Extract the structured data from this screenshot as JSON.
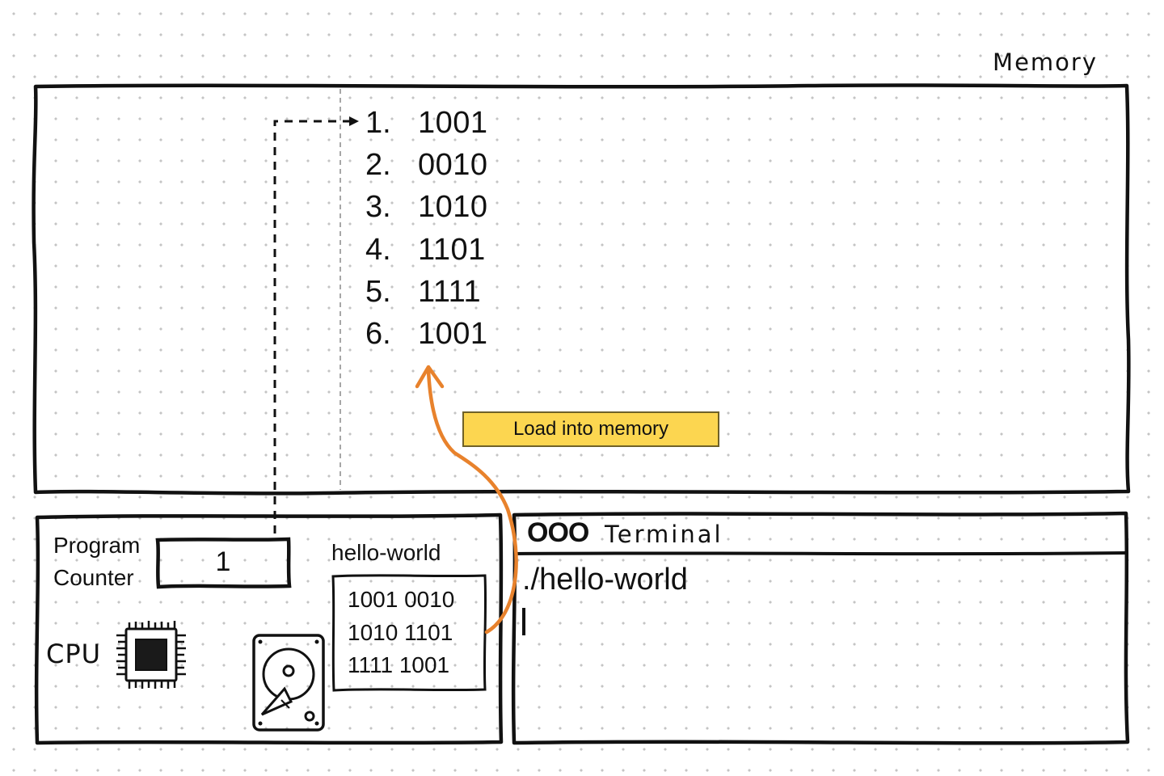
{
  "memory": {
    "title": "Memory",
    "rows": [
      {
        "index": "1.",
        "value": "1001"
      },
      {
        "index": "2.",
        "value": "0010"
      },
      {
        "index": "3.",
        "value": "1010"
      },
      {
        "index": "4.",
        "value": "1101"
      },
      {
        "index": "5.",
        "value": "1111"
      },
      {
        "index": "6.",
        "value": "1001"
      }
    ]
  },
  "load_label": "Load into memory",
  "cpu": {
    "pc_label_line1": "Program",
    "pc_label_line2": "Counter",
    "pc_value": "1",
    "label": "CPU"
  },
  "disk": {
    "file_name": "hello-world",
    "lines": [
      "1001 0010",
      "1010 1101",
      "1111 1001"
    ]
  },
  "terminal": {
    "window_dots": "OOO",
    "title": "Terminal",
    "command": "./hello-world"
  },
  "colors": {
    "stroke": "#111111",
    "dot_grid": "#c4c4c4",
    "badge_fill": "#fcd650",
    "arrow": "#e8822c"
  },
  "icons": [
    "cpu-chip-icon",
    "hard-drive-icon"
  ]
}
